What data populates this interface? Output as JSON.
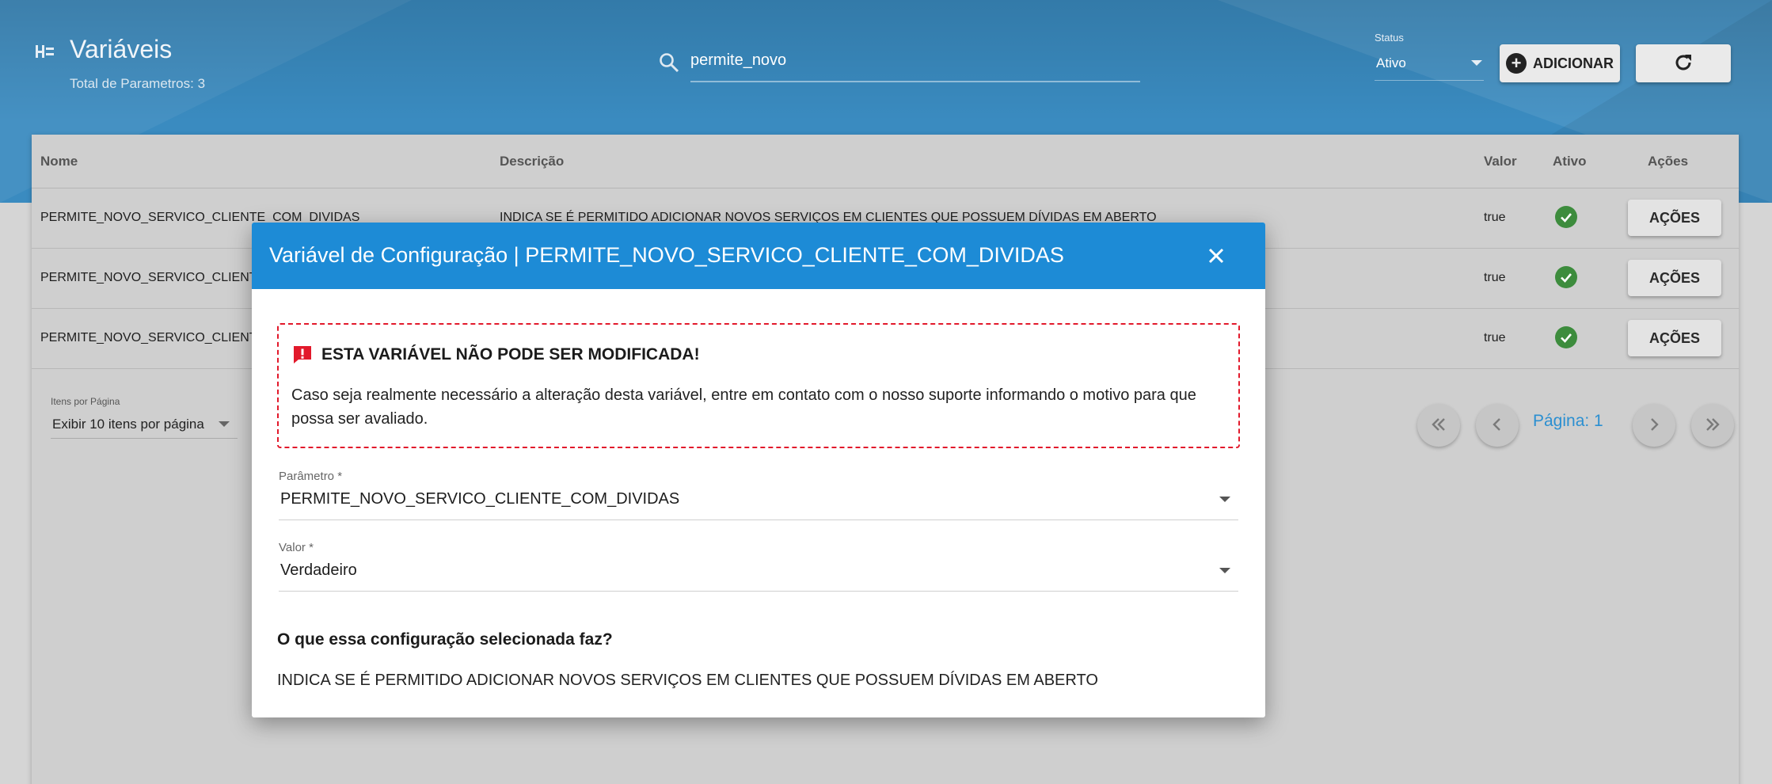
{
  "header": {
    "title": "Variáveis",
    "subtitle": "Total de Parametros: 3",
    "search": {
      "value": "permite_novo",
      "placeholder": ""
    },
    "status": {
      "label": "Status",
      "value": "Ativo"
    },
    "add_label": "ADICIONAR",
    "icons": {
      "title": "list-icon",
      "search": "search-icon",
      "add": "plus-circle-icon",
      "refresh": "refresh-icon"
    }
  },
  "table": {
    "columns": [
      "Nome",
      "Descrição",
      "Valor",
      "Ativo",
      "Ações"
    ],
    "rows": [
      {
        "nome": "PERMITE_NOVO_SERVICO_CLIENTE_COM_DIVIDAS",
        "descricao": "INDICA SE É PERMITIDO ADICIONAR NOVOS SERVIÇOS EM CLIENTES QUE POSSUEM DÍVIDAS EM ABERTO",
        "valor": "true",
        "acoes": "AÇÕES"
      },
      {
        "nome": "PERMITE_NOVO_SERVICO_CLIENT",
        "descricao": "",
        "valor": "true",
        "acoes": "AÇÕES"
      },
      {
        "nome": "PERMITE_NOVO_SERVICO_CLIENT",
        "descricao": "",
        "valor": "true",
        "acoes": "AÇÕES"
      }
    ],
    "active_color": "#3d8c3d"
  },
  "pagination": {
    "per_page_label": "Itens por Página",
    "per_page_value": "Exibir 10 itens por página",
    "page_label": "Página: 1"
  },
  "modal": {
    "title": "Variável de Configuração | PERMITE_NOVO_SERVICO_CLIENTE_COM_DIVIDAS",
    "header_color": "#1d8bd6",
    "alert": {
      "title": "ESTA VARIÁVEL NÃO PODE SER MODIFICADA!",
      "text": "Caso seja realmente necessário a alteração desta variável, entre em contato com o nosso suporte informando o motivo para que possa ser avaliado.",
      "color": "#e2192b"
    },
    "fields": {
      "parametro": {
        "label": "Parâmetro *",
        "value": "PERMITE_NOVO_SERVICO_CLIENTE_COM_DIVIDAS"
      },
      "valor": {
        "label": "Valor *",
        "value": "Verdadeiro"
      }
    },
    "question": "O que essa configuração selecionada faz?",
    "description": "INDICA SE É PERMITIDO ADICIONAR NOVOS SERVIÇOS EM CLIENTES QUE POSSUEM DÍVIDAS EM ABERTO"
  }
}
